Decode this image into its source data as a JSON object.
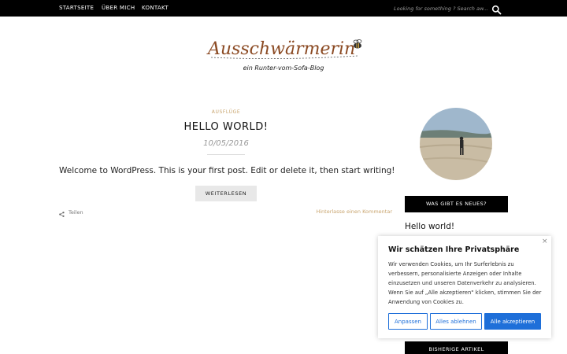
{
  "nav": {
    "items": [
      {
        "label": "STARTSEITE"
      },
      {
        "label": "ÜBER MICH"
      },
      {
        "label": "KONTAKT"
      }
    ],
    "search_placeholder": "Looking for something ? Search aw...",
    "search_icon": "search-icon"
  },
  "header": {
    "logo_text": "Ausschwärmerin",
    "logo_icon": "bee-icon",
    "tagline": "ein Runter-vom-Sofa-Blog"
  },
  "post": {
    "category": "AUSFLÜGE",
    "title": "HELLO WORLD!",
    "date": "10/05/2016",
    "excerpt": "Welcome to WordPress. This is your first post. Edit or delete it, then start writing!",
    "read_more": "WEITERLESEN",
    "share_label": "Teilen",
    "share_icon": "share-icon",
    "comment_link": "Hinterlasse einen Kommentar"
  },
  "sidebar": {
    "widget_news_title": "WAS GIBT ES NEUES?",
    "recent_post": "Hello world!",
    "widget_archive_title": "BISHERIGE ARTIKEL"
  },
  "cookie": {
    "title": "Wir schätzen Ihre Privatsphäre",
    "text": "Wir verwenden Cookies, um Ihr Surferlebnis zu verbessern, personalisierte Anzeigen oder Inhalte einzusetzen und unseren Datenverkehr zu analysieren. Wenn Sie auf „Alle akzeptieren\" klicken, stimmen Sie der Anwendung von Cookies zu.",
    "btn_customize": "Anpassen",
    "btn_reject": "Alles ablehnen",
    "btn_accept": "Alle akzeptieren",
    "close_symbol": "×"
  },
  "colors": {
    "accent": "#c8a46e",
    "logo_brown": "#8b4a23",
    "button_blue": "#1e6fd9",
    "topbar": "#000000"
  }
}
